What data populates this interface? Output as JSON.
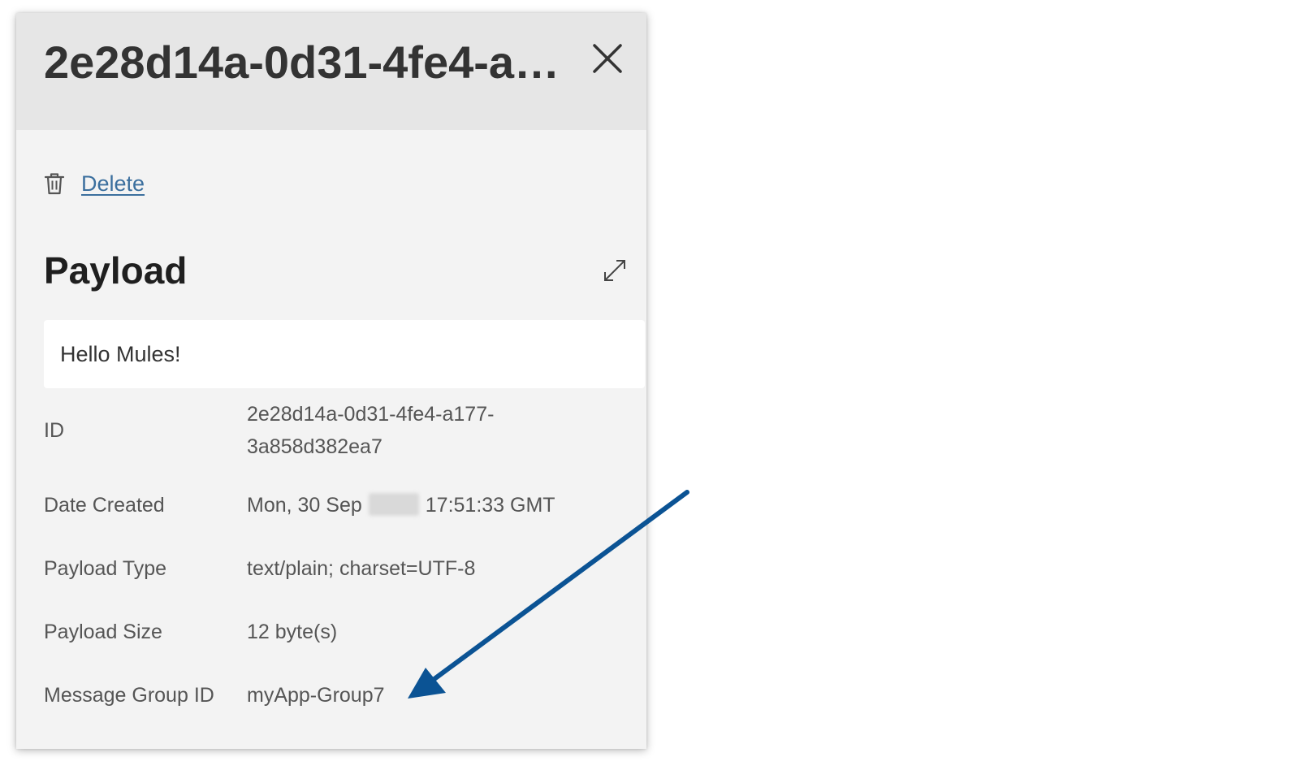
{
  "panel": {
    "title": "2e28d14a-0d31-4fe4-a177-3a858d382ea7",
    "close_icon": "close-x-icon",
    "delete_label": "Delete",
    "delete_icon": "trash-icon",
    "section_title": "Payload",
    "expand_icon": "expand-diagonal-icon",
    "payload_text": "Hello Mules!",
    "fields": {
      "id_label": "ID",
      "id_value_line1": "2e28d14a-0d31-4fe4-a177-",
      "id_value_line2": "3a858d382ea7",
      "date_label": "Date Created",
      "date_value_prefix": "Mon, 30 Sep",
      "date_value_suffix": "17:51:33 GMT",
      "type_label": "Payload Type",
      "type_value": "text/plain; charset=UTF-8",
      "size_label": "Payload Size",
      "size_value": "12 byte(s)",
      "group_label": "Message Group ID",
      "group_value": "myApp-Group7"
    }
  },
  "colors": {
    "header_bg": "#e6e6e6",
    "panel_bg": "#f3f3f3",
    "link": "#3b6f9e",
    "annotation_arrow": "#0b5394"
  }
}
